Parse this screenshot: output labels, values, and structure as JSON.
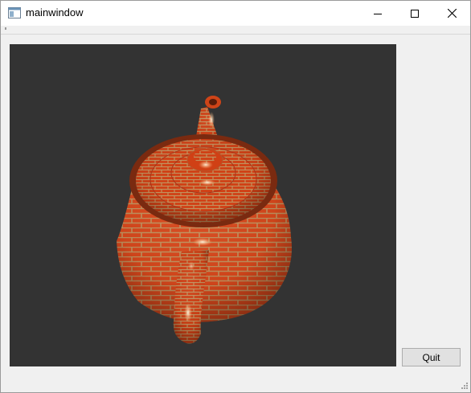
{
  "window": {
    "title": "mainwindow",
    "icon": "app-window-icon",
    "controls": [
      "minimize-icon",
      "maximize-icon",
      "close-icon"
    ]
  },
  "viewport": {
    "content": "3d-render",
    "background_color": "#333333",
    "object_color": "#d9481c"
  },
  "buttons": {
    "quit_label": "Quit"
  }
}
